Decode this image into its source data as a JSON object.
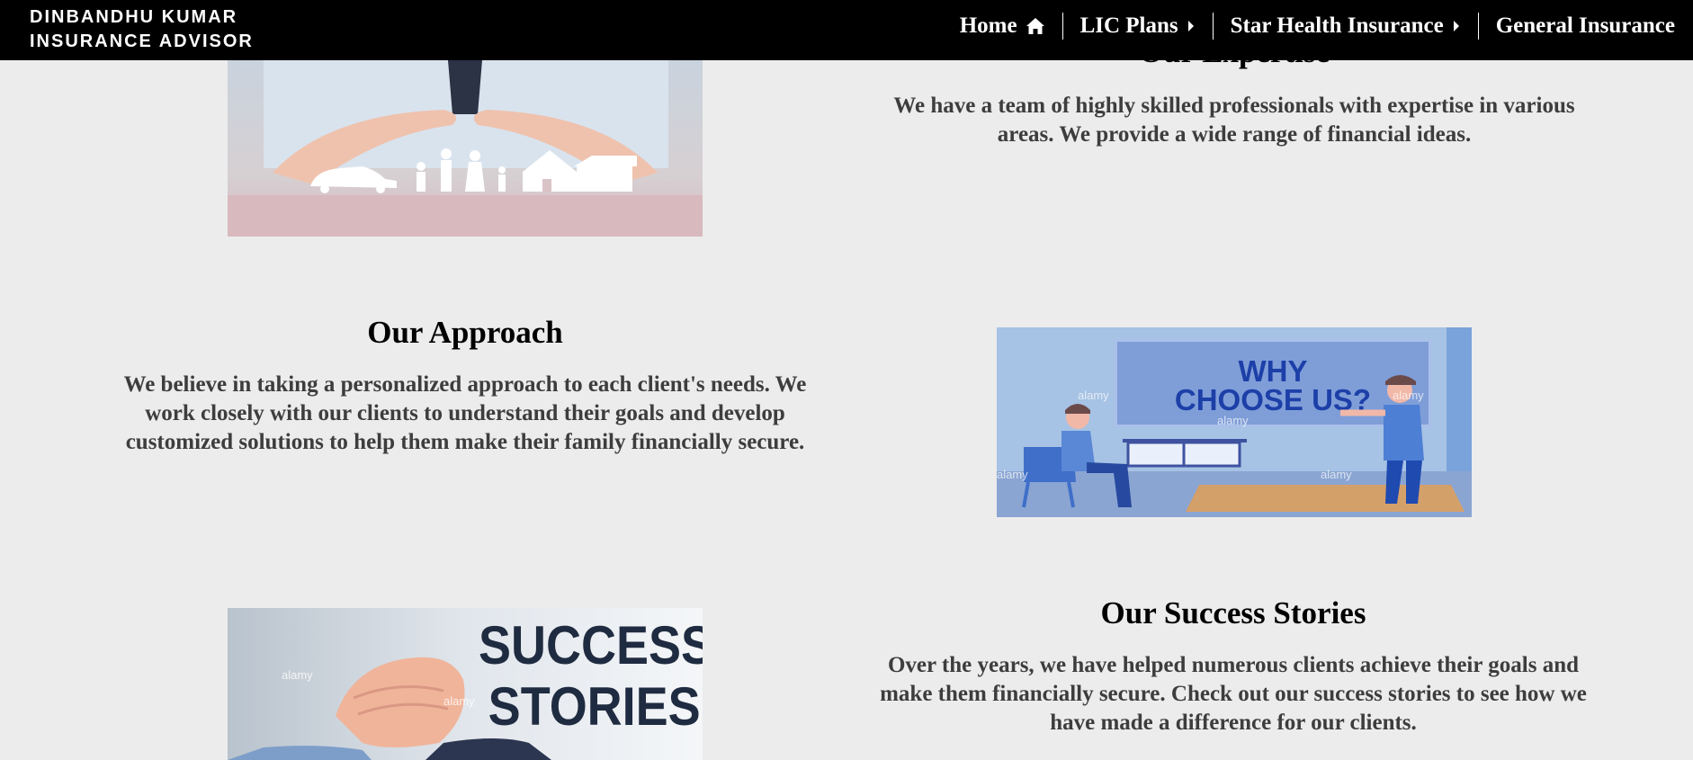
{
  "brand": {
    "line1": "DINBANDHU KUMAR",
    "line2": "INSURANCE ADVISOR"
  },
  "nav": [
    {
      "label": "Home",
      "icon": "home-icon"
    },
    {
      "label": "LIC Plans",
      "icon": "caret-right-icon"
    },
    {
      "label": "Star Health Insurance",
      "icon": "caret-right-icon"
    },
    {
      "label": "General Insurance"
    }
  ],
  "sections": {
    "expertise": {
      "title": "Our Expertise",
      "text": "We have a team of highly skilled professionals with expertise in various areas. We provide a wide range of financial ideas."
    },
    "approach": {
      "title": "Our Approach",
      "text": "We believe in taking a personalized approach to each client's needs. We work closely with our clients to understand their goals and develop customized solutions to help them make their family financially secure."
    },
    "success": {
      "title": "Our Success Stories",
      "text": "Over the years, we have helped numerous clients achieve their goals and make them financially secure. Check out our success stories to see how we have made a difference for our clients."
    }
  },
  "images": {
    "why_choose": {
      "line1": "WHY",
      "line2": "CHOOSE US?",
      "watermark": "alamy"
    },
    "success": {
      "line1": "SUCCESS",
      "line2": "STORIES",
      "watermark": "alamy"
    }
  },
  "colors": {
    "navbar": "#000000",
    "background": "#ececec",
    "heading": "#000000",
    "body_text": "#3d3d3d"
  }
}
